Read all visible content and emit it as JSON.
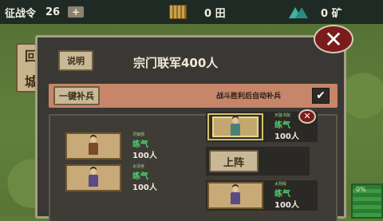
{
  "topbar": {
    "orders": {
      "label": "征战令",
      "value": "26",
      "plus": "+"
    },
    "fields": {
      "value": "0 田",
      "icon": "field-icon"
    },
    "ore": {
      "value": "0 矿",
      "icon": "ore-crystal-icon"
    }
  },
  "background": {
    "sign_chars": [
      "回",
      "城"
    ],
    "progress_text": "0%"
  },
  "panel": {
    "info_button": "说明",
    "title": "宗门联军400人",
    "close_icon": "✕",
    "supply_button": "一键补兵",
    "auto_supply_label": "战斗胜利后自动补兵",
    "auto_supply_checked": true,
    "check_icon": "✔",
    "remove_icon": "✕",
    "deploy_button": "上阵"
  },
  "units": [
    {
      "name": "灵娘部",
      "realm": "练气",
      "count": "100人",
      "color": "brown"
    },
    {
      "name": "太清宫",
      "realm": "练气",
      "count": "100人",
      "color": "purple"
    },
    {
      "name": "天璇书院",
      "realm": "练气",
      "count": "100人",
      "color": "teal"
    },
    {
      "name": "太阴殿",
      "realm": "练气",
      "count": "100人",
      "color": "purple"
    }
  ]
}
